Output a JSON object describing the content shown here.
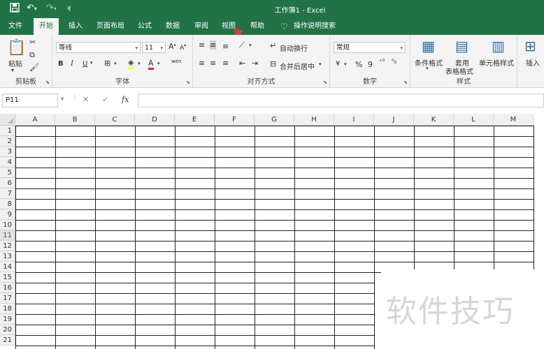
{
  "window": {
    "title": "工作簿1  -  Excel"
  },
  "quick_access": {
    "save_icon": "save-icon",
    "undo_icon": "undo-icon",
    "redo_icon": "redo-icon",
    "customize_icon": "customize-icon"
  },
  "tabs": [
    "文件",
    "开始",
    "插入",
    "页面布局",
    "公式",
    "数据",
    "审阅",
    "视图",
    "帮助"
  ],
  "active_tab": "开始",
  "search": {
    "label": "操作说明搜索"
  },
  "ribbon": {
    "clipboard": {
      "label": "剪贴板",
      "paste": "粘贴"
    },
    "font": {
      "label": "字体",
      "font_name": "等线",
      "font_size": "11",
      "bold": "B",
      "italic": "I",
      "underline": "U",
      "grow": "A",
      "shrink": "A",
      "fill": "A",
      "wen": "wén"
    },
    "alignment": {
      "label": "对齐方式",
      "wrap": "自动换行",
      "merge": "合并后居中"
    },
    "number": {
      "label": "数字",
      "format": "常规",
      "percent": "%",
      "comma": "9",
      "currency": "¥"
    },
    "styles": {
      "label": "样式",
      "conditional": "条件格式",
      "table_1": "套用",
      "table_2": "表格格式",
      "cell_styles": "单元格样式"
    },
    "cells": {
      "insert": "插入"
    }
  },
  "formula_bar": {
    "name_box": "P11",
    "cancel": "✕",
    "enter": "✓",
    "fx": "fx",
    "value": ""
  },
  "sheet": {
    "columns": [
      "A",
      "B",
      "C",
      "D",
      "E",
      "F",
      "G",
      "H",
      "I",
      "J",
      "K",
      "L",
      "M"
    ],
    "rows": [
      "1",
      "2",
      "3",
      "4",
      "5",
      "6",
      "7",
      "8",
      "9",
      "10",
      "11",
      "12",
      "13",
      "14",
      "15",
      "16",
      "17",
      "18",
      "19",
      "20",
      "21"
    ]
  },
  "watermark": "软件技巧"
}
